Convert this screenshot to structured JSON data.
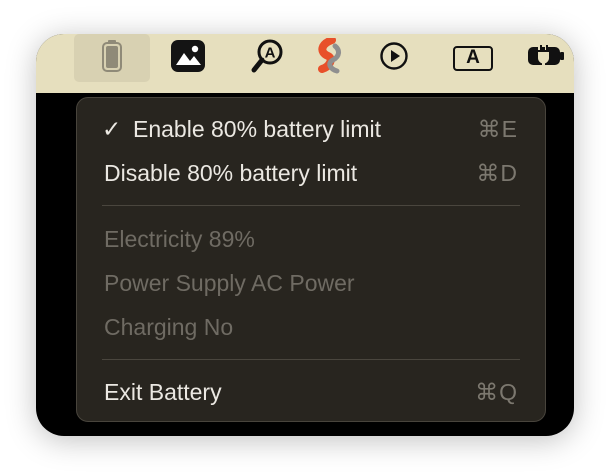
{
  "menubar": {
    "icons": [
      {
        "name": "battery-icon",
        "active": true
      },
      {
        "name": "photo-icon"
      },
      {
        "name": "search-a-icon"
      },
      {
        "name": "s-app-icon"
      },
      {
        "name": "play-circle-icon"
      },
      {
        "name": "input-source-a-icon",
        "glyph": "A"
      },
      {
        "name": "charging-plug-icon"
      }
    ]
  },
  "menu": {
    "items": [
      {
        "label": "Enable 80% battery limit",
        "shortcut": "⌘E",
        "checked": true,
        "check_glyph": "✓"
      },
      {
        "label": "Disable 80% battery limit",
        "shortcut": "⌘D"
      }
    ],
    "info": [
      {
        "label": "Electricity 89%"
      },
      {
        "label": "Power Supply AC Power"
      },
      {
        "label": "Charging No"
      }
    ],
    "exit": {
      "label": "Exit Battery",
      "shortcut": "⌘Q"
    }
  },
  "colors": {
    "menubar_bg": "#e6dfbe",
    "menu_bg": "#28251f",
    "text": "#ebe8e2",
    "disabled_text": "#6f6b63",
    "shortcut_text": "#7c786f",
    "accent_red": "#e8502a"
  }
}
